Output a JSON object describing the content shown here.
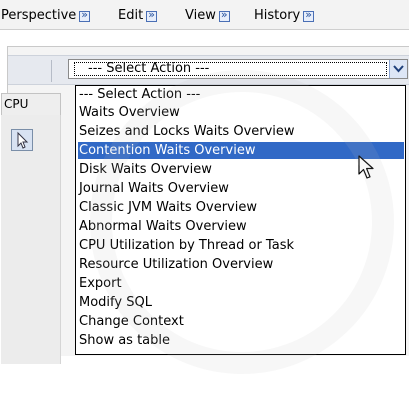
{
  "menu": {
    "items": [
      {
        "label": "Perspective",
        "icon": "double-arrow-icon"
      },
      {
        "label": "Edit",
        "icon": "double-arrow-icon"
      },
      {
        "label": "View",
        "icon": "double-arrow-icon"
      },
      {
        "label": "History",
        "icon": "double-arrow-icon"
      }
    ]
  },
  "action_select": {
    "value": "--- Select Action ---",
    "icon": "chevron-down-icon"
  },
  "side_tab": {
    "label": "CPU"
  },
  "dropdown": {
    "selected_index": 3,
    "options": [
      "--- Select Action ---",
      "Waits Overview",
      "Seizes and Locks Waits Overview",
      "Contention Waits Overview",
      "Disk Waits Overview",
      "Journal Waits Overview",
      "Classic JVM Waits Overview",
      "Abnormal Waits Overview",
      "CPU Utilization by Thread or Task",
      "Resource Utilization Overview",
      "Export",
      "Modify SQL",
      "Change Context",
      "Show as table"
    ]
  },
  "colors": {
    "highlight": "#3169c6",
    "menu_bar": "#f3f3f3"
  }
}
